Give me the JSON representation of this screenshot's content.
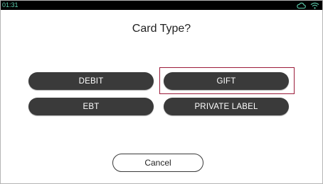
{
  "status_bar": {
    "time": "01:31",
    "icons": [
      "cloud-icon",
      "wifi-icon"
    ]
  },
  "title": "Card Type?",
  "buttons": {
    "debit": "DEBIT",
    "gift": "GIFT",
    "ebt": "EBT",
    "private_label": "PRIVATE LABEL"
  },
  "selected": "GIFT",
  "cancel": "Cancel",
  "colors": {
    "button_bg": "#3a3a3a",
    "selection_outline": "#9b1c3a",
    "status_text": "#5fd0b0"
  }
}
